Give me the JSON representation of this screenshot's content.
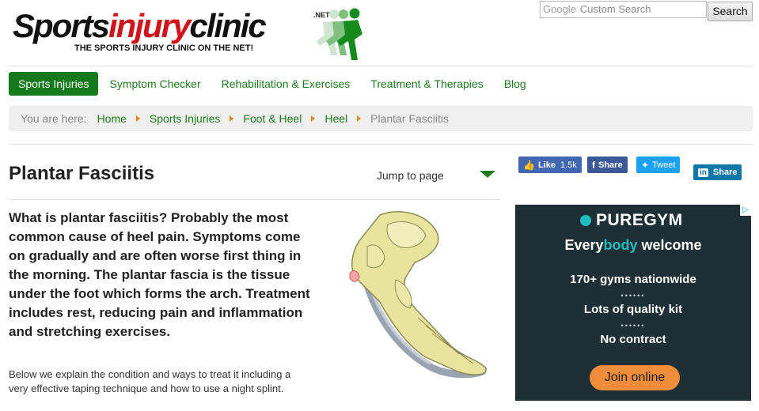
{
  "header": {
    "logo_part1": "Sports",
    "logo_part2": "injury",
    "logo_part3": "clinic",
    "logo_net": ".NET",
    "tagline": "THE SPORTS INJURY CLINIC ON THE NET!",
    "search_brand": "Google",
    "search_placeholder": "Custom Search",
    "search_button": "Search"
  },
  "nav": {
    "items": [
      {
        "label": "Sports Injuries",
        "active": true
      },
      {
        "label": "Symptom Checker"
      },
      {
        "label": "Rehabilitation & Exercises"
      },
      {
        "label": "Treatment & Therapies"
      },
      {
        "label": "Blog"
      }
    ]
  },
  "breadcrumb": {
    "label": "You are here:",
    "links": [
      "Home",
      "Sports Injuries",
      "Foot & Heel",
      "Heel"
    ],
    "current": "Plantar Fasciitis"
  },
  "page": {
    "title": "Plantar Fasciitis",
    "jump_label": "Jump to page"
  },
  "social": {
    "like_label": "Like",
    "like_count": "1.5k",
    "fb_share": "Share",
    "tweet": "Tweet",
    "linkedin_share": "Share",
    "linkedin_logo": "in"
  },
  "article": {
    "lead": "What is plantar fasciitis? Probably the most common cause of heel pain. Symptoms come on gradually and are often worse first thing in the morning. The plantar fascia is the tissue under the foot which forms the arch. Treatment includes rest, reducing pain and inflammation and stretching exercises.",
    "intro": "Below we explain the condition and ways to treat it including a very effective taping technique and how to use a night splint."
  },
  "ad": {
    "brand": "PUREGYM",
    "welcome_1": "Every",
    "welcome_2": "body",
    "welcome_3": " welcome",
    "line1": "170+ gyms nationwide",
    "line2": "Lots of quality kit",
    "line3": "No contract",
    "cta": "Join online",
    "dots": "••••••",
    "accent": "#1ebdc0",
    "cta_color": "#f08c3a"
  }
}
